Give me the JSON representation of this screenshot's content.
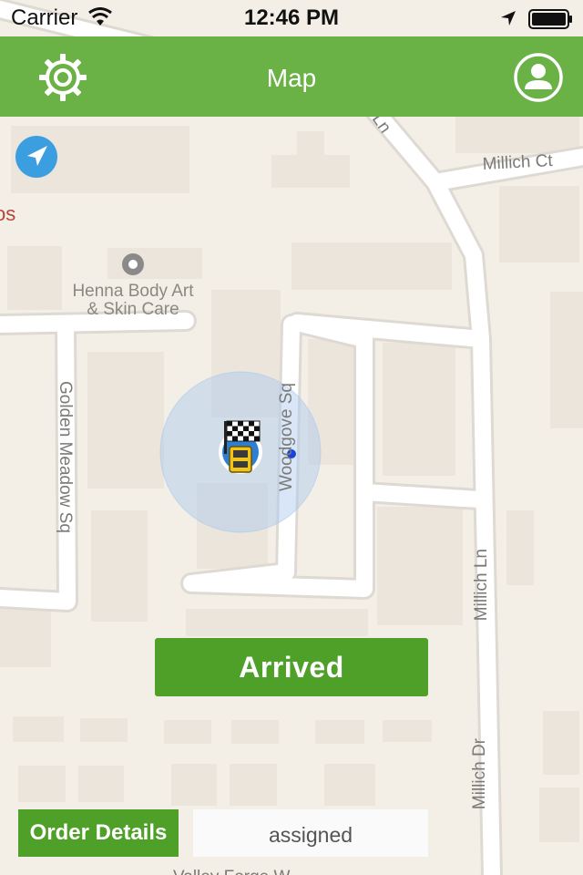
{
  "status_bar": {
    "carrier": "Carrier",
    "time": "12:46 PM"
  },
  "nav": {
    "title": "Map",
    "left_icon": "settings-gear-icon",
    "right_icon": "user-profile-icon"
  },
  "map": {
    "labels": {
      "poi_line1": "Henna Body Art",
      "poi_line2": "& Skin Care",
      "cut_label": "os",
      "millich_ct": "Millich Ct",
      "top_ln": "Ln",
      "golden_meadow": "Golden Meadow Sq",
      "woodgove": "Woodgove Sq",
      "millich_ln": "Millich Ln",
      "millich_dr": "Millich Dr",
      "bottom_cut": "Valley Forge W"
    },
    "markers": {
      "destination": "checkered-flag-icon",
      "vehicle": "taxi-icon",
      "locate": "navigation-arrow-icon"
    },
    "colors": {
      "land": "#f4efe6",
      "road": "#ffffff",
      "building": "#ebe5db",
      "accuracy": "#a8c8f0"
    }
  },
  "actions": {
    "arrived_label": "Arrived",
    "order_details_label": "Order Details",
    "status_value": "assigned"
  },
  "theme": {
    "nav_green": "#6ab245",
    "button_green": "#4ea028"
  }
}
